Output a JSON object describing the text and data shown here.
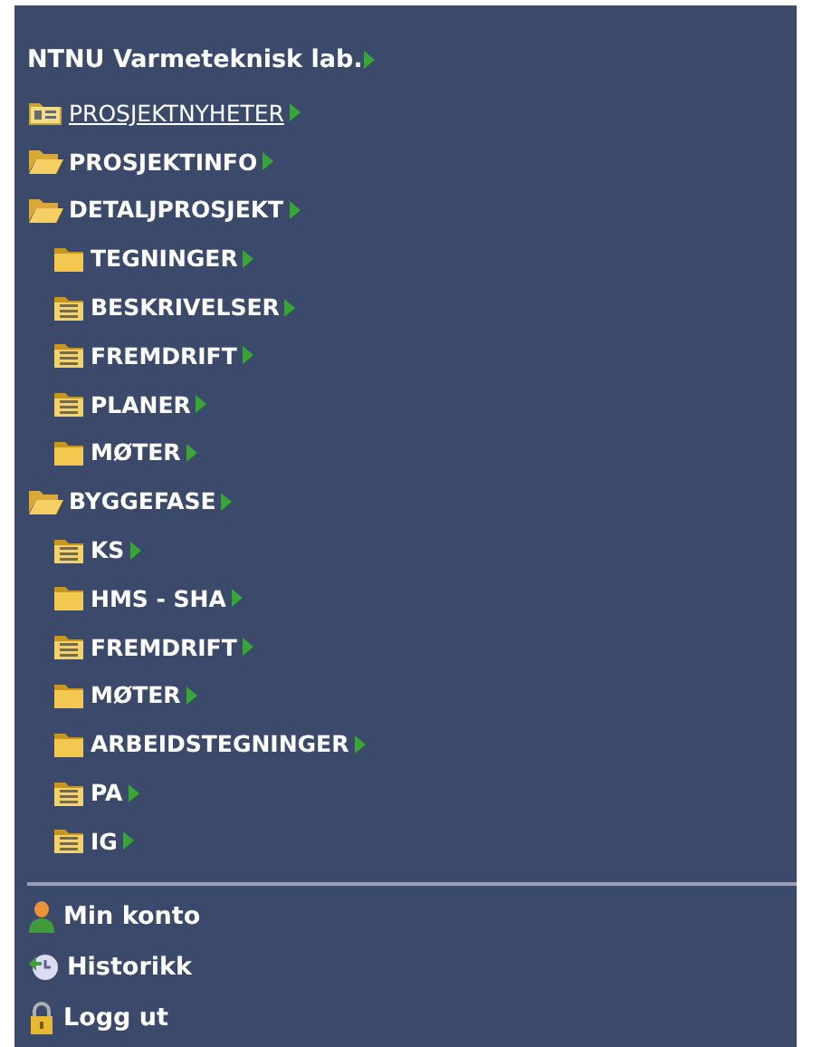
{
  "title": "NTNU Varmeteknisk lab.",
  "menu": [
    {
      "label": "PROSJEKTNYHETER",
      "kind": "card",
      "selected": true
    },
    {
      "label": "PROSJEKTINFO",
      "kind": "open",
      "selected": false
    },
    {
      "label": "DETALJPROSJEKT",
      "kind": "open",
      "selected": false,
      "children": [
        {
          "label": "TEGNINGER",
          "kind": "closed",
          "selected": false
        },
        {
          "label": "BESKRIVELSER",
          "kind": "notes",
          "selected": false
        },
        {
          "label": "FREMDRIFT",
          "kind": "notes",
          "selected": false
        },
        {
          "label": "PLANER",
          "kind": "notes",
          "selected": false
        },
        {
          "label": "MØTER",
          "kind": "closed",
          "selected": false
        }
      ]
    },
    {
      "label": "BYGGEFASE",
      "kind": "open",
      "selected": false,
      "children": [
        {
          "label": "KS",
          "kind": "notes",
          "selected": false
        },
        {
          "label": "HMS - SHA",
          "kind": "closed",
          "selected": false
        },
        {
          "label": "FREMDRIFT",
          "kind": "notes",
          "selected": false
        },
        {
          "label": "MØTER",
          "kind": "closed",
          "selected": false
        },
        {
          "label": "ARBEIDSTEGNINGER",
          "kind": "closed",
          "selected": false
        },
        {
          "label": "PA",
          "kind": "notes",
          "selected": false
        },
        {
          "label": "IG",
          "kind": "notes",
          "selected": false
        }
      ]
    }
  ],
  "account": [
    {
      "label": "Min konto"
    },
    {
      "label": "Historikk"
    },
    {
      "label": "Logg ut"
    }
  ]
}
